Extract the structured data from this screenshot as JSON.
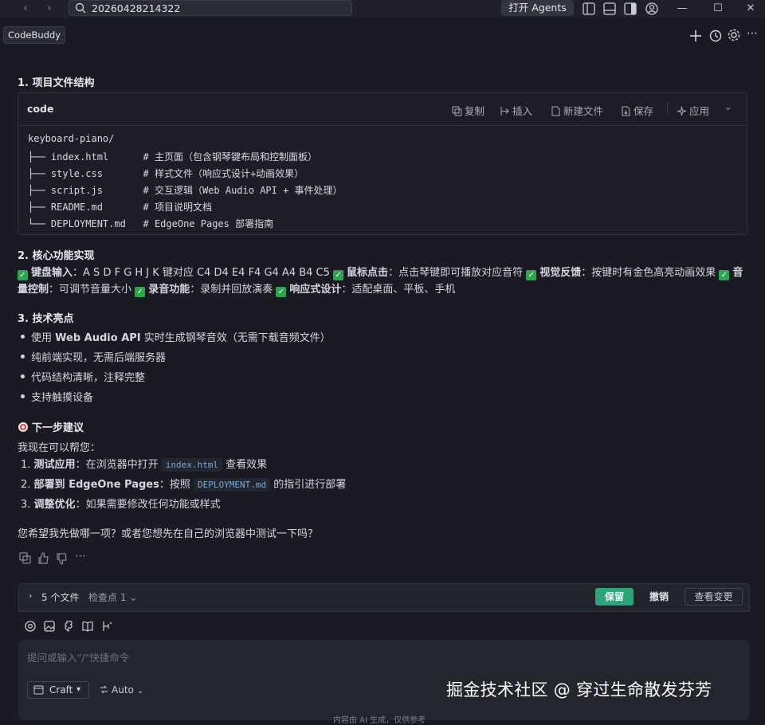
{
  "titlebar": {
    "search_value": "20260428214322",
    "agents_button": "打开 Agents",
    "window_controls": [
      "—",
      "☐",
      "✕"
    ]
  },
  "tab": {
    "label": "CodeBuddy"
  },
  "section1": {
    "heading": "1. 项目文件结构",
    "code": {
      "language": "code",
      "actions": [
        "复制",
        "插入",
        "新建文件",
        "保存",
        "应用"
      ],
      "lines": [
        "keyboard-piano/",
        "├── index.html      # 主页面（包含钢琴键布局和控制面板）",
        "├── style.css       # 样式文件（响应式设计+动画效果）",
        "├── script.js       # 交互逻辑（Web Audio API + 事件处理）",
        "├── README.md       # 项目说明文档",
        "└── DEPLOYMENT.md   # EdgeOne Pages 部署指南"
      ]
    }
  },
  "section2": {
    "heading": "2. 核心功能实现",
    "features": [
      {
        "title": "键盘输入",
        "desc": "A S D F G H J K 键对应 C4 D4 E4 F4 G4 A4 B4 C5"
      },
      {
        "title": "鼠标点击",
        "desc": "点击琴键即可播放对应音符"
      },
      {
        "title": "视觉反馈",
        "desc": "按键时有金色高亮动画效果"
      },
      {
        "title": "音量控制",
        "desc": "可调节音量大小"
      },
      {
        "title": "录音功能",
        "desc": "录制并回放演奏"
      },
      {
        "title": "响应式设计",
        "desc": "适配桌面、平板、手机"
      }
    ]
  },
  "section3": {
    "heading": "3. 技术亮点",
    "bullets": [
      {
        "pre": "使用 ",
        "bold": "Web Audio API",
        "post": " 实时生成钢琴音效（无需下载音频文件）"
      },
      {
        "pre": "纯前端实现，无需后端服务器",
        "bold": "",
        "post": ""
      },
      {
        "pre": "代码结构清晰，注释完整",
        "bold": "",
        "post": ""
      },
      {
        "pre": "支持触摸设备",
        "bold": "",
        "post": ""
      }
    ]
  },
  "next": {
    "heading": "下一步建议",
    "intro": "我现在可以帮您：",
    "items": [
      {
        "num": "1.",
        "title": "测试应用",
        "pre": "在浏览器中打开 ",
        "code": "index.html",
        "post": " 查看效果"
      },
      {
        "num": "2.",
        "title": "部署到 EdgeOne Pages",
        "pre": "按照 ",
        "code": "DEPLOYMENT.md",
        "post": " 的指引进行部署"
      },
      {
        "num": "3.",
        "title": "调整优化",
        "pre": "如果需要修改任何功能或样式",
        "code": "",
        "post": ""
      }
    ],
    "question": "您希望我先做哪一项？或者您想先在自己的浏览器中测试一下吗？"
  },
  "changes": {
    "files": "5 个文件",
    "checkpoint": "检查点 1",
    "keep": "保留",
    "undo": "撤销",
    "review": "查看变更"
  },
  "input": {
    "placeholder": "提问或输入\"/\"快捷命令",
    "mode": "Craft",
    "model": "Auto"
  },
  "watermark": "掘金技术社区 @ 穿过生命散发芬芳",
  "footnote": "内容由 AI 生成，仅供参考"
}
